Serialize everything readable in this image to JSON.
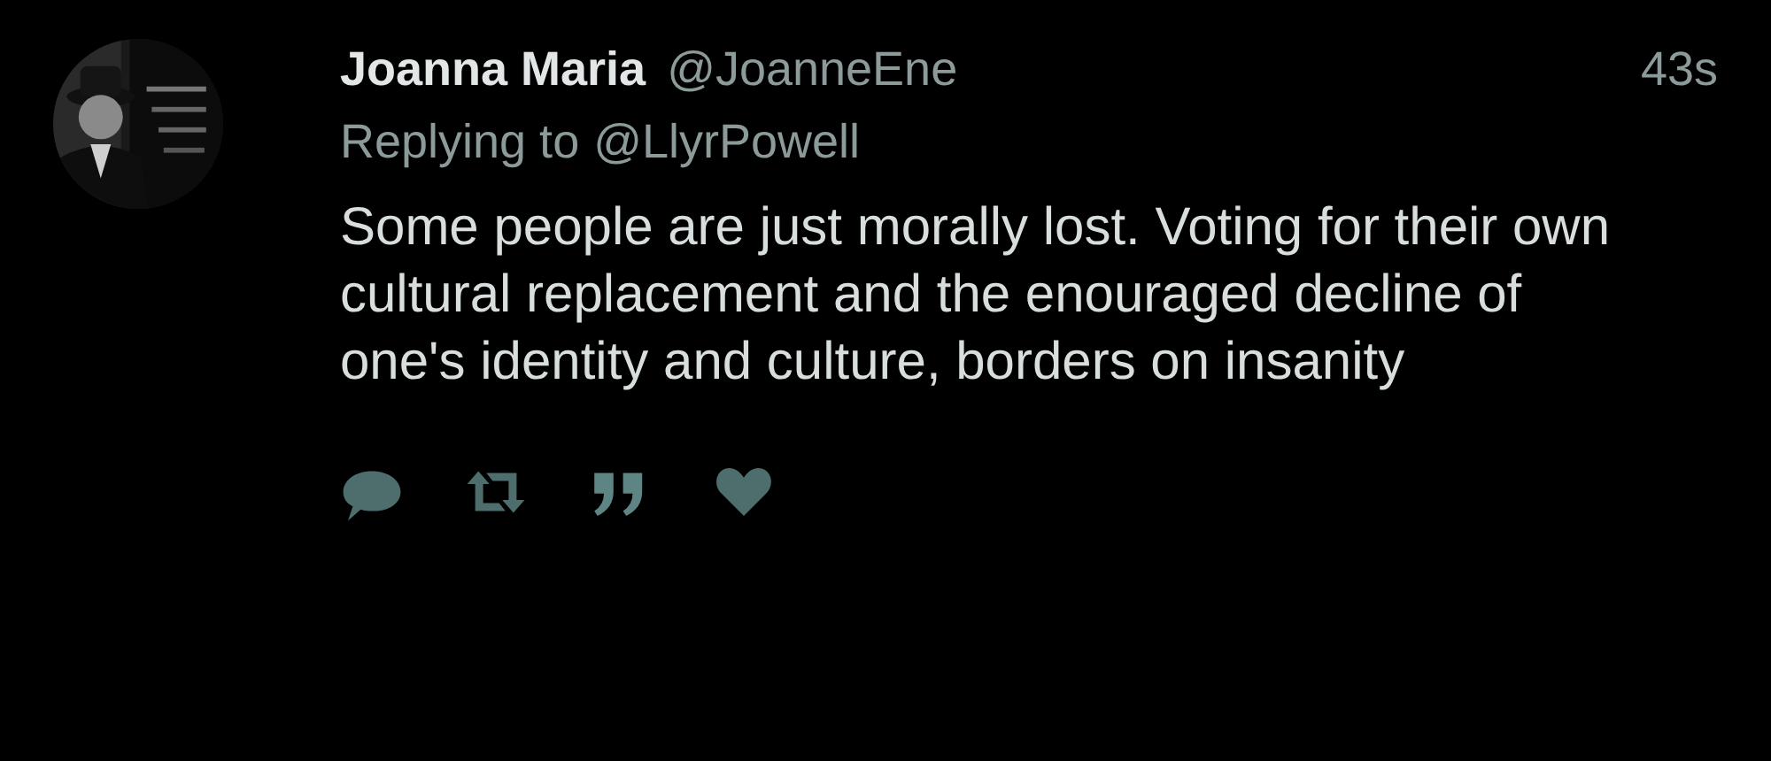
{
  "tweet": {
    "display_name": "Joanna Maria",
    "handle": "@JoanneEne",
    "time": "43s",
    "reply_prefix": "Replying to",
    "reply_to": "@LlyrPowell",
    "text": "Some people are just morally lost. Voting for their own cultural replacement and the enouraged decline of one's identity and culture, borders on insanity"
  }
}
